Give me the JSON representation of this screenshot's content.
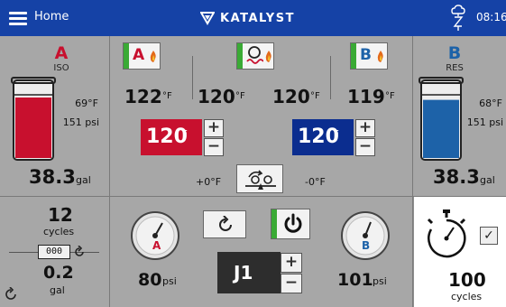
{
  "topbar": {
    "home_label": "Home",
    "brand": "KATALYST",
    "time": "08:16",
    "menu_icon": "hamburger-menu-icon",
    "brand_icon": "katalyst-logo-icon",
    "status_icon": "cloud-antenna-icon",
    "color": "#1542a6"
  },
  "tank_a": {
    "letter": "A",
    "subtitle": "ISO",
    "temp_reading": "69°F",
    "psi_reading": "151 psi",
    "gallons": "38.3",
    "gallons_unit": "gal",
    "fill_level": 0.78,
    "color": "#c8102e"
  },
  "tank_b": {
    "letter": "B",
    "subtitle": "RES",
    "temp_reading": "68°F",
    "psi_reading": "151 psi",
    "gallons": "38.3",
    "gallons_unit": "gal",
    "fill_level": 0.75,
    "color": "#1d62a8"
  },
  "heaters": {
    "a_label": "A",
    "b_label": "B",
    "hose_icon": "hose-heater-icon",
    "flame_icon": "flame-icon",
    "temps": [
      "122",
      "120",
      "120",
      "119"
    ],
    "temp_unit": "°F"
  },
  "setpoints": {
    "a_value": "120",
    "b_value": "120",
    "unit": "F",
    "a_offset": "+0°F",
    "b_offset": "-0°F",
    "a_color": "#c8102e",
    "b_color": "#0b2d8f",
    "plus": "+",
    "minus": "−",
    "balance_icon": "temperature-balance-icon"
  },
  "counter": {
    "cycles_value": "12",
    "cycles_label": "cycles",
    "counter_digits": "000",
    "gal_value": "0.2",
    "gal_unit": "gal"
  },
  "pumps": {
    "gauge_a_letter": "A",
    "gauge_b_letter": "B",
    "psi_a": "80",
    "psi_b": "101",
    "psi_unit": "psi",
    "j1_label": "J1",
    "plus": "+",
    "minus": "−",
    "power_icon": "power-icon",
    "reset_icon": "reset-icon"
  },
  "timer": {
    "value": "100",
    "unit": "cycles",
    "check": "✓",
    "timer_icon": "stopwatch-icon"
  }
}
